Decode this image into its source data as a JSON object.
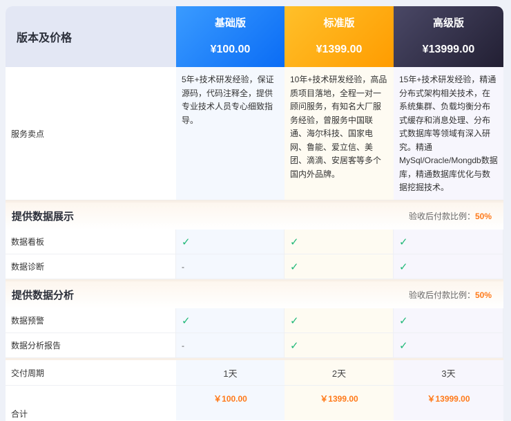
{
  "header": {
    "title": "版本及价格",
    "plans": [
      {
        "name": "基础版",
        "price": "¥100.00"
      },
      {
        "name": "标准版",
        "price": "¥1399.00"
      },
      {
        "name": "高级版",
        "price": "¥13999.00"
      }
    ]
  },
  "service": {
    "label": "服务卖点",
    "descriptions": [
      "5年+技术研发经验，保证源码，代码注释全，提供专业技术人员专心细致指导。",
      "10年+技术研发经验，高品质项目落地，全程一对一顾问服务，有知名大厂服务经验，曾服务中国联通、海尔科技、国家电网、鲁能、爱立信、美团、滴滴、安居客等多个国内外品牌。",
      "15年+技术研发经验，精通分布式架构相关技术，在系统集群、负载均衡分布式缓存和消息处理、分布式数据库等领域有深入研究。精通MySql/Oracle/Mongdb数据库，精通数据库优化与数据挖掘技术。"
    ]
  },
  "sections": [
    {
      "title": "提供数据展示",
      "ratio_label": "验收后付款比例：",
      "ratio_value": "50%",
      "rows": [
        {
          "label": "数据看板",
          "cells": [
            "✓",
            "✓",
            "✓"
          ]
        },
        {
          "label": "数据诊断",
          "cells": [
            "-",
            "✓",
            "✓"
          ]
        }
      ]
    },
    {
      "title": "提供数据分析",
      "ratio_label": "验收后付款比例：",
      "ratio_value": "50%",
      "rows": [
        {
          "label": "数据预警",
          "cells": [
            "✓",
            "✓",
            "✓"
          ]
        },
        {
          "label": "数据分析报告",
          "cells": [
            "-",
            "✓",
            "✓"
          ]
        }
      ]
    }
  ],
  "delivery": {
    "label": "交付周期",
    "values": [
      "1天",
      "2天",
      "3天"
    ]
  },
  "total": {
    "label": "合计",
    "values": [
      "￥100.00",
      "￥1399.00",
      "￥13999.00"
    ]
  },
  "colors": {
    "basic": "#0a6cf5",
    "standard": "#ff9c00",
    "premium": "#221f33",
    "check": "#1fb877",
    "accent": "#ff7a1a"
  }
}
